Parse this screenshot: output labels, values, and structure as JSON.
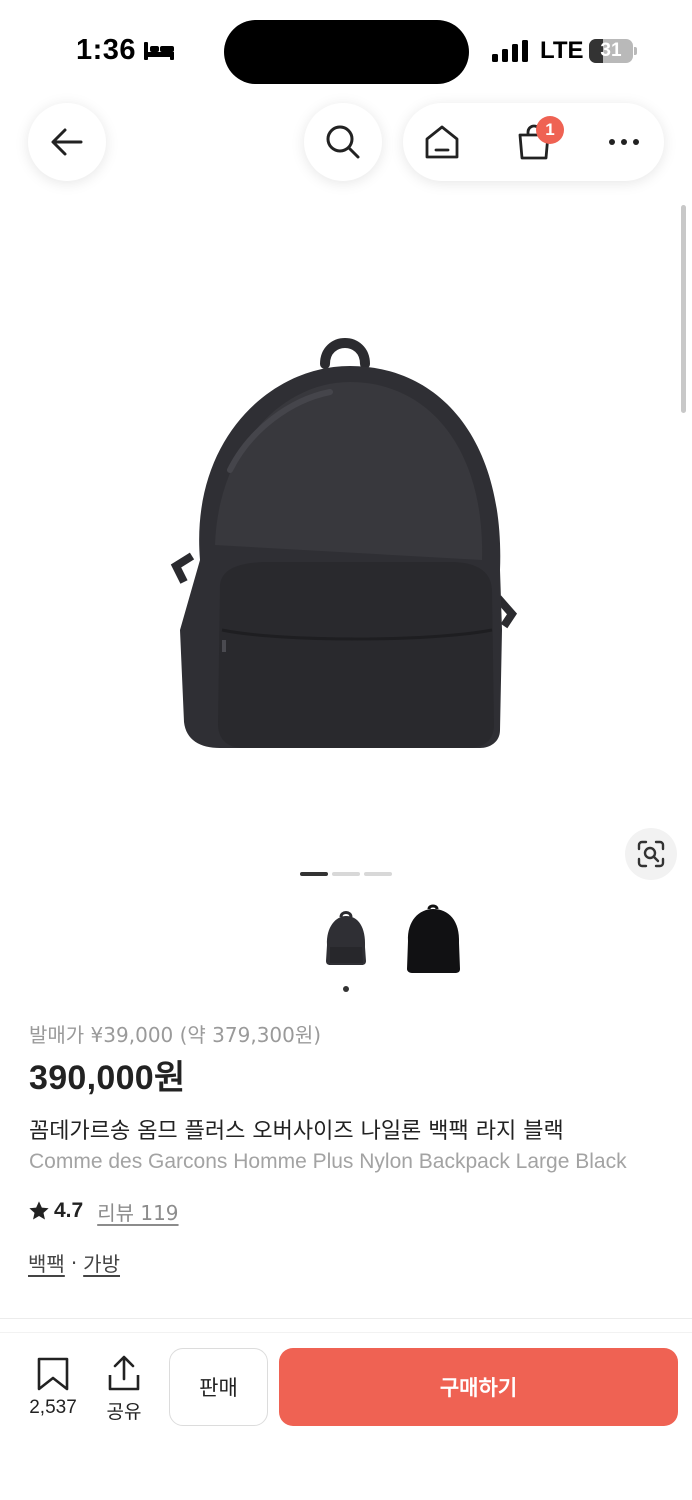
{
  "status_bar": {
    "time": "1:36",
    "network": "LTE",
    "battery_level": "31",
    "battery_fraction": 0.31
  },
  "nav": {
    "cart_count": "1"
  },
  "gallery": {
    "page_count": 3,
    "active_page": 1
  },
  "product": {
    "release_price": "발매가 ¥39,000 (약 379,300원)",
    "price": "390,000원",
    "name_ko": "꼼데가르송 옴므 플러스 오버사이즈 나일론 백팩 라지 블랙",
    "name_en": "Comme des Garcons Homme Plus Nylon Backpack Large Black",
    "rating": "4.7",
    "review_label": "리뷰 119",
    "tags": [
      "백팩",
      "가방"
    ],
    "tag_separator": "·"
  },
  "bottom_bar": {
    "bookmark_count": "2,537",
    "share_label": "공유",
    "sell_label": "판매",
    "buy_label": "구매하기"
  },
  "colors": {
    "accent": "#ef6253",
    "text_primary": "#222222",
    "text_secondary": "#9a9a9a"
  },
  "icons": [
    "bed-icon",
    "signal-icon",
    "battery-icon",
    "back-arrow-icon",
    "search-icon",
    "home-icon",
    "shopping-bag-icon",
    "more-icon",
    "image-search-icon",
    "star-icon",
    "bookmark-icon",
    "share-icon"
  ]
}
